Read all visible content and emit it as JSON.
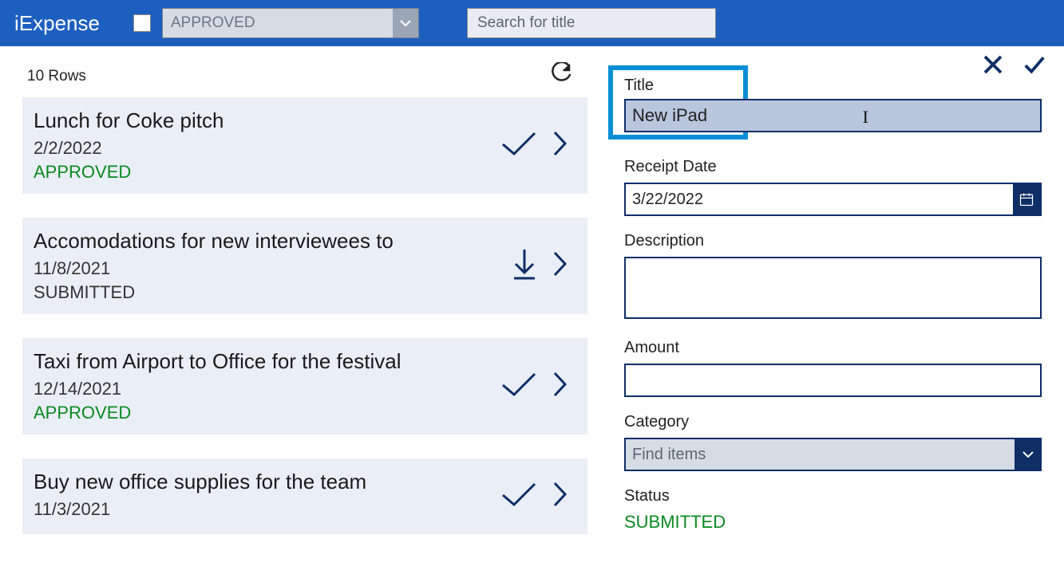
{
  "header": {
    "app_title": "iExpense",
    "filter_value": "APPROVED",
    "search_placeholder": "Search for title"
  },
  "list": {
    "count_label": "10 Rows",
    "items": [
      {
        "title": "Lunch for Coke pitch",
        "date": "2/2/2022",
        "status": "APPROVED",
        "status_class": "st-approved",
        "icon": "check"
      },
      {
        "title": "Accomodations for new interviewees to",
        "date": "11/8/2021",
        "status": "SUBMITTED",
        "status_class": "st-submitted",
        "icon": "download"
      },
      {
        "title": "Taxi from Airport to Office for the festival",
        "date": "12/14/2021",
        "status": "APPROVED",
        "status_class": "st-approved",
        "icon": "check"
      },
      {
        "title": "Buy new office supplies for the team",
        "date": "11/3/2021",
        "status": "",
        "status_class": "",
        "icon": "check"
      }
    ]
  },
  "form": {
    "title_label": "Title",
    "title_value": "New iPad",
    "date_label": "Receipt Date",
    "date_value": "3/22/2022",
    "desc_label": "Description",
    "desc_value": "",
    "amount_label": "Amount",
    "amount_value": "",
    "category_label": "Category",
    "category_placeholder": "Find items",
    "status_label": "Status",
    "status_value": "SUBMITTED"
  }
}
